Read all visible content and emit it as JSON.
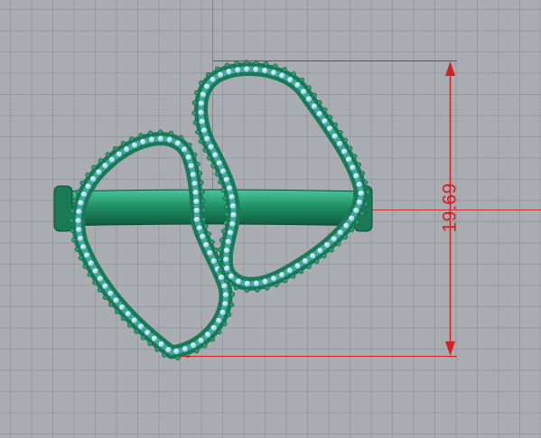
{
  "viewport": {
    "name": "front-view",
    "background_color": "#a9adb1",
    "grid_color": "#878a8e"
  },
  "model": {
    "metal_color": "#1f8c63",
    "gem_color": "#9fd8ea",
    "prong_color": "#2a9a74"
  },
  "dimension": {
    "value": "19.69",
    "color": "#d42020"
  }
}
